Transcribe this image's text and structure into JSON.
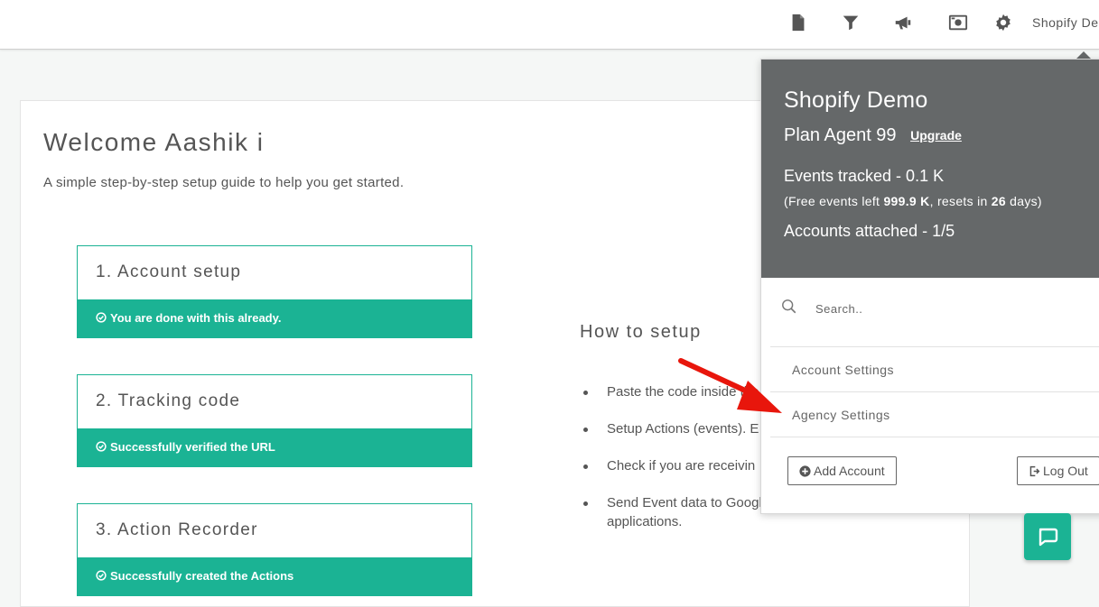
{
  "topbar": {
    "icons": [
      "document-icon",
      "filter-icon",
      "megaphone-icon",
      "camera-icon",
      "gear-icon"
    ],
    "account_name": "Shopify Demo"
  },
  "welcome": {
    "title": "Welcome Aashik i",
    "subtitle": "A simple step-by-step setup guide to help you get started."
  },
  "steps": [
    {
      "title": "1. Account setup",
      "status": "You are done with this already."
    },
    {
      "title": "2. Tracking code",
      "status": "Successfully verified the URL"
    },
    {
      "title": "3. Action Recorder",
      "status": "Successfully created the Actions"
    }
  ],
  "howto": {
    "title": "How to setup",
    "items": [
      "Paste the code inside the website you want to track.",
      "Setup Actions (events). E",
      "Check if you are receivin",
      "Send Event data to Google Analytics / CRM / Other applications."
    ]
  },
  "dropdown": {
    "account_name": "Shopify Demo",
    "plan": "Plan Agent 99",
    "upgrade": "Upgrade",
    "events_tracked": "Events tracked - 0.1 K",
    "free_prefix": "(Free events left ",
    "free_left": "999.9 K",
    "free_middle": ", resets in ",
    "free_days": "26",
    "free_suffix": " days)",
    "accounts_attached": "Accounts attached - 1/5",
    "search_placeholder": "Search..",
    "menu": [
      "Account Settings",
      "Agency Settings"
    ],
    "add_account": "Add Account",
    "log_out": "Log Out"
  },
  "colors": {
    "accent": "#1bb394",
    "dropdown_header": "#656869",
    "annotation_arrow": "#e8160c"
  }
}
